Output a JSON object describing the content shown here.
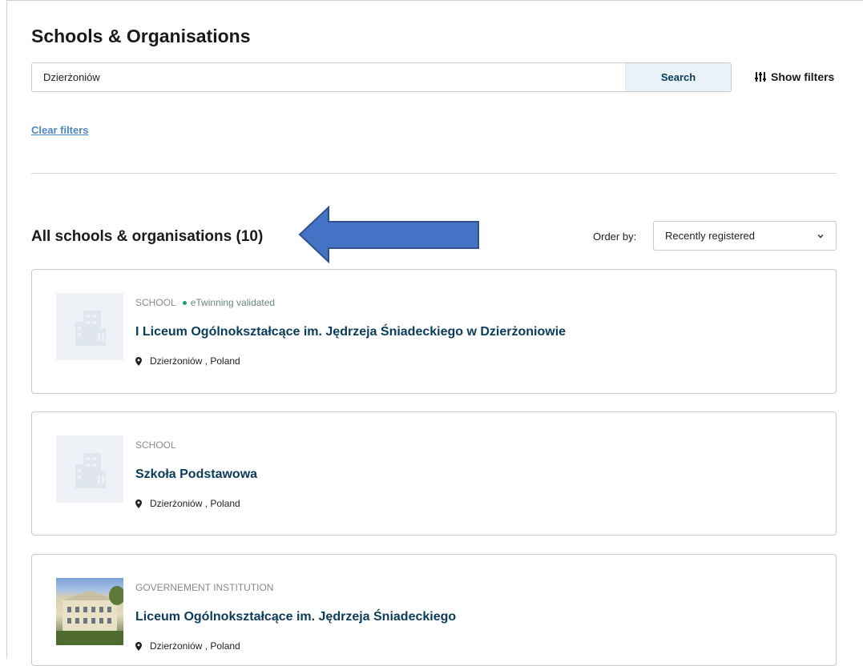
{
  "header": {
    "title": "Schools & Organisations"
  },
  "search": {
    "value": "Dzierżoniów",
    "button_label": "Search"
  },
  "filters": {
    "show_label": "Show filters",
    "clear_label": "Clear filters"
  },
  "results": {
    "heading": "All schools & organisations (10)",
    "order_label": "Order by:",
    "order_value": "Recently registered"
  },
  "cards": [
    {
      "type": "SCHOOL",
      "validated": "eTwinning validated",
      "name": "I Liceum Ogólnokształcące im. Jędrzeja Śniadeckiego w Dzierżoniowie",
      "location": "Dzierżoniów , Poland",
      "icon": "building-icon"
    },
    {
      "type": "SCHOOL",
      "name": "Szkoła Podstawowa",
      "location": "Dzierżoniów , Poland",
      "icon": "building-icon"
    },
    {
      "type": "GOVERNEMENT INSTITUTION",
      "name": "Liceum Ogólnokształcące im. Jędrzeja Śniadeckiego",
      "location": "Dzierżoniów , Poland",
      "icon": "school-photo"
    }
  ],
  "colors": {
    "accent": "#0b3b5c",
    "link": "#4d86c4",
    "validated_dot": "#1f9d6b",
    "arrow_fill": "#4472c4"
  }
}
